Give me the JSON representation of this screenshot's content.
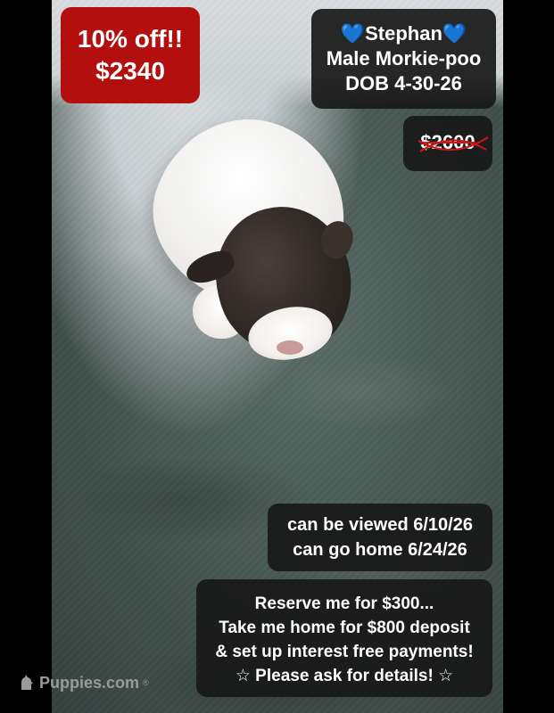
{
  "discount": {
    "line1": "10% off!!",
    "line2": "$2340"
  },
  "puppy": {
    "heart_left": "💙",
    "name": "Stephan",
    "heart_right": "💙",
    "breed": "Male Morkie-poo",
    "dob": "DOB 4-30-26"
  },
  "old_price": "$2600",
  "dates": {
    "viewed": "can be viewed 6/10/26",
    "home": "can go home 6/24/26"
  },
  "reserve": {
    "line1": "Reserve me for $300...",
    "line2": "Take me home for $800 deposit",
    "line3": "& set up interest free payments!",
    "line4": "☆ Please ask for details! ☆"
  },
  "watermark": {
    "text": "Puppies.com",
    "mark": "®"
  },
  "colors": {
    "discount_bg": "#b30f0f",
    "badge_bg": "#181818",
    "heart": "#2f9be8",
    "strike": "#d01515"
  },
  "icons": {
    "heart": "blue-heart-icon",
    "watermark_logo": "dog-silhouette-icon"
  }
}
